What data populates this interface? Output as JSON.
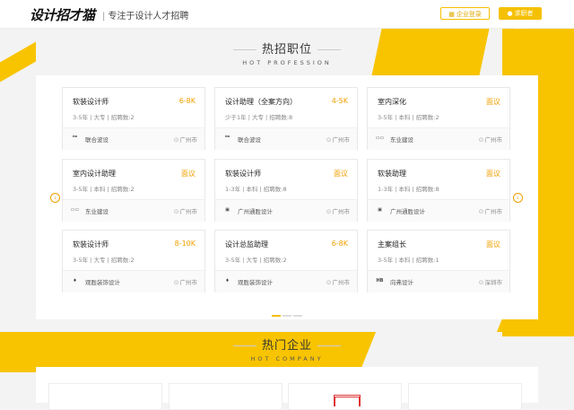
{
  "header": {
    "logo": "设计招才猫",
    "slogan": "专注于设计人才招聘",
    "btn_company": "企业登录",
    "btn_seeker": "求职者登录"
  },
  "hot_profession": {
    "title_cn": "热招职位",
    "title_en": "HOT PROFESSION",
    "cards": [
      {
        "title": "软装设计师",
        "salary": "6-8K",
        "meta": "3-5年 | 大专 | 招聘数:2",
        "company": "联合波设",
        "location": "广州市",
        "logo": "ᴴᴰ"
      },
      {
        "title": "设计助理（全案方向）",
        "salary": "4-5K",
        "meta": "少于1年 | 大专 | 招聘数:8",
        "company": "联合波设",
        "location": "广州市",
        "logo": "ᴴᴰ"
      },
      {
        "title": "室内深化",
        "salary": "面议",
        "meta": "3-5年 | 本科 | 招聘数:2",
        "company": "东业建设",
        "location": "广州市",
        "logo": "▭▭"
      },
      {
        "title": "室内设计助理",
        "salary": "面议",
        "meta": "3-5年 | 本科 | 招聘数:2",
        "company": "东业建设",
        "location": "广州市",
        "logo": "▭▭"
      },
      {
        "title": "软装设计师",
        "salary": "面议",
        "meta": "1-3年 | 本科 | 招聘数:8",
        "company": "广州通胜设计",
        "location": "广州市",
        "logo": "▣"
      },
      {
        "title": "软装助理",
        "salary": "面议",
        "meta": "1-3年 | 本科 | 招聘数:8",
        "company": "广州通胜设计",
        "location": "广州市",
        "logo": "▣"
      },
      {
        "title": "软装设计师",
        "salary": "8-10K",
        "meta": "3-5年 | 大专 | 招聘数:2",
        "company": "观胜装饰设计",
        "location": "广州市",
        "logo": "♦"
      },
      {
        "title": "设计总监助理",
        "salary": "6-8K",
        "meta": "3-5年 | 大专 | 招聘数:2",
        "company": "观胜装饰设计",
        "location": "广州市",
        "logo": "♦"
      },
      {
        "title": "主案组长",
        "salary": "面议",
        "meta": "3-5年 | 本科 | 招聘数:1",
        "company": "向弗设计",
        "location": "深圳市",
        "logo": "HB"
      }
    ]
  },
  "hot_company": {
    "title_cn": "热门企业",
    "title_en": "HOT COMPANY"
  },
  "colors": {
    "accent": "#f8c400",
    "salary": "#f0a000"
  }
}
